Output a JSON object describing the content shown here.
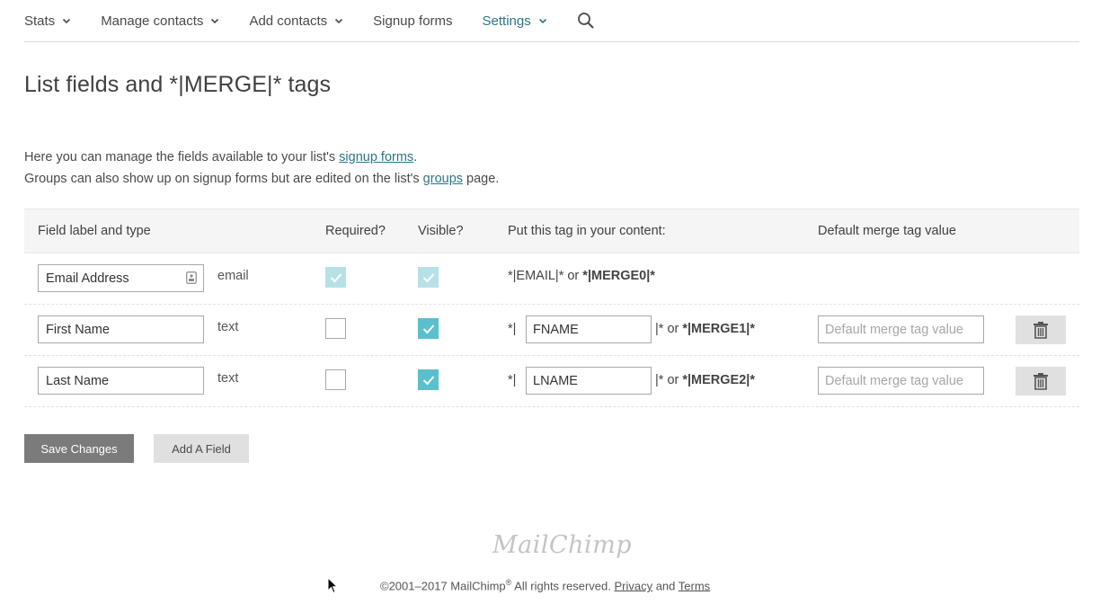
{
  "nav": {
    "items": [
      {
        "label": "Stats",
        "has_dropdown": true,
        "active": false
      },
      {
        "label": "Manage contacts",
        "has_dropdown": true,
        "active": false
      },
      {
        "label": "Add contacts",
        "has_dropdown": true,
        "active": false
      },
      {
        "label": "Signup forms",
        "has_dropdown": false,
        "active": false
      },
      {
        "label": "Settings",
        "has_dropdown": true,
        "active": true
      }
    ],
    "search_icon": "search-icon",
    "accent_color": "#2b7686"
  },
  "page": {
    "title": "List fields and *|MERGE|* tags",
    "intro_line1_before": "Here you can manage the fields available to your list's ",
    "intro_line1_link": "signup forms",
    "intro_line1_after": ".",
    "intro_line2_before": "Groups can also show up on signup forms but are edited on the list's ",
    "intro_line2_link": "groups",
    "intro_line2_after": " page."
  },
  "table": {
    "headers": {
      "field": "Field label and type",
      "required": "Required?",
      "visible": "Visible?",
      "tag": "Put this tag in your content:",
      "default": "Default merge tag value"
    },
    "rows": [
      {
        "label": "Email Address",
        "type": "email",
        "required": true,
        "visible": true,
        "locked": true,
        "tag_full_prefix": "*|EMAIL|* or ",
        "tag_merge": "*|MERGE0|*"
      },
      {
        "label": "First Name",
        "type": "text",
        "required": false,
        "visible": true,
        "tag_prefix": "*|",
        "tag_value": "FNAME",
        "tag_suffix": "|* or ",
        "tag_merge": "*|MERGE1|*",
        "default_placeholder": "Default merge tag value"
      },
      {
        "label": "Last Name",
        "type": "text",
        "required": false,
        "visible": true,
        "tag_prefix": "*|",
        "tag_value": "LNAME",
        "tag_suffix": "|* or ",
        "tag_merge": "*|MERGE2|*",
        "default_placeholder": "Default merge tag value"
      }
    ],
    "checkbox_color": "#5bbfcc"
  },
  "buttons": {
    "save": "Save Changes",
    "add": "Add A Field"
  },
  "footer": {
    "logo": "MailChimp",
    "copyright": "©2001–2017 MailChimp",
    "reg": "®",
    "rights": " All rights reserved. ",
    "privacy": "Privacy",
    "and": " and ",
    "terms": "Terms"
  }
}
